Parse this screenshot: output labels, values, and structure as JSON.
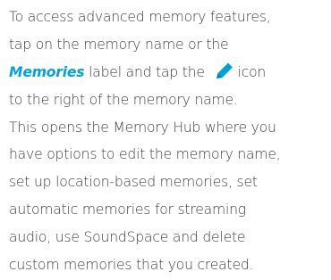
{
  "paragraph": {
    "line1": "To access advanced memory features,",
    "line2": "tap on the memory name or the",
    "line3_keyword": "Memories",
    "line3_a": " label and tap the ",
    "line3_b": "icon",
    "line4": "to the right of the memory name.",
    "line5": "This opens the Memory Hub where you",
    "line6": "have options to edit the memory name,",
    "line7": "set up location-based memories, set",
    "line8": "automatic memories for streaming",
    "line9": "audio, use SoundSpace and delete",
    "line10": "custom memories that you created."
  },
  "icons": {
    "edit": "pencil-icon"
  },
  "colors": {
    "text": "#3f3f3f",
    "accent": "#00a3d9"
  }
}
